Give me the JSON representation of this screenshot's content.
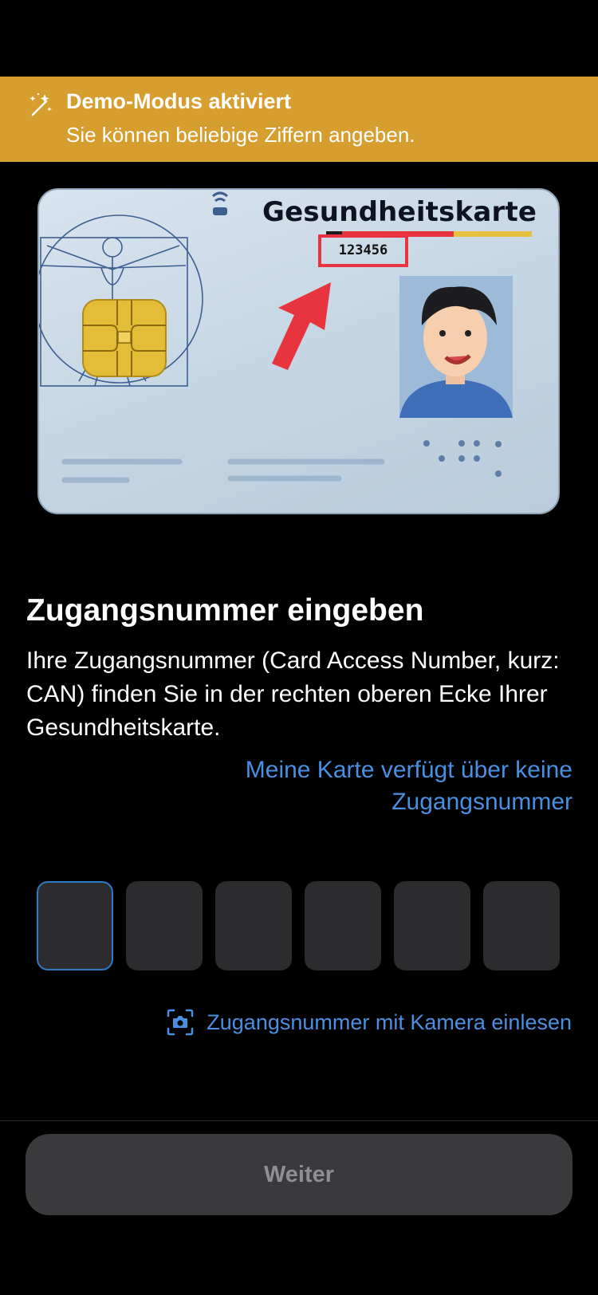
{
  "banner": {
    "title": "Demo-Modus aktiviert",
    "subtitle": "Sie können beliebige Ziffern angeben.",
    "icon": "magic-wand-icon",
    "color": "#d69e2f"
  },
  "card": {
    "title": "Gesundheitskarte",
    "number": "123456",
    "highlight_color": "#e8343f"
  },
  "content": {
    "heading": "Zugangsnummer eingeben",
    "description": "Ihre Zugangsnummer (Card Access Number, kurz: CAN) finden Sie in der rechten oberen Ecke Ihrer Gesundheitskarte.",
    "no_can_link": "Meine Karte verfügt über keine Zugangsnummer"
  },
  "can_input": {
    "digits": [
      "",
      "",
      "",
      "",
      "",
      ""
    ],
    "focused_index": 0
  },
  "camera": {
    "label": "Zugangsnummer mit Kamera einlesen",
    "icon": "camera-viewfinder-icon"
  },
  "footer": {
    "continue_label": "Weiter"
  },
  "colors": {
    "accent": "#4a90e2",
    "background": "#000000"
  }
}
